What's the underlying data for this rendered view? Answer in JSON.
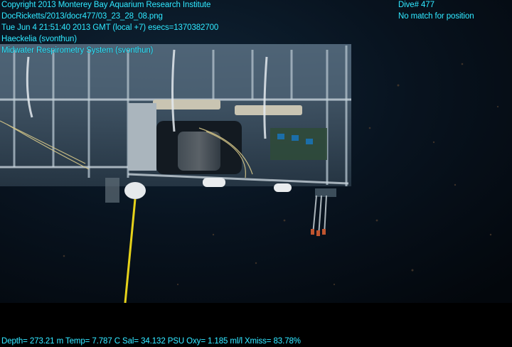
{
  "overlay": {
    "copyright": "Copyright 2013 Monterey Bay Aquarium Research Institute",
    "image_path": "DocRicketts/2013/docr477/03_23_28_08.png",
    "timestamp": "Tue Jun  4 21:51:40 2013 GMT (local +7)  esecs=1370382700",
    "observation_1": "Haeckelia (svonthun)",
    "observation_2": "Midwater Respirometry System (svonthun)",
    "dive": "Dive# 477",
    "position_status": "No match for position",
    "sensor_line": "Depth= 273.21 m  Temp= 7.787 C  Sal= 34.132 PSU  Oxy= 1.185 ml/l  Xmiss= 83.78%"
  }
}
